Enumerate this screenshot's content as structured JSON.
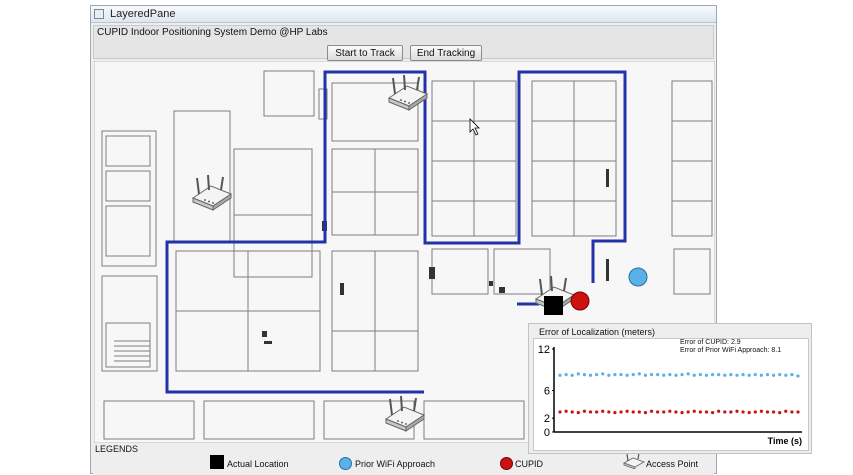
{
  "window": {
    "title": "LayeredPane"
  },
  "header": {
    "system_title": "CUPID Indoor Positioning System Demo @HP Labs",
    "start_button": "Start to Track",
    "end_button": "End Tracking"
  },
  "legend": {
    "title": "LEGENDS",
    "actual_location": "Actual Location",
    "prior_wifi": "Prior WiFi Approach",
    "cupid": "CUPID",
    "access_point": "Access Point"
  },
  "chart": {
    "panel_title": "Error of Localization (meters)",
    "cupid_error_text": "Error of CUPID: 2.9",
    "prior_error_text": "Error of Prior WiFi Approach: 8.1",
    "xlabel": "Time (s)"
  },
  "chart_data": {
    "type": "scatter",
    "title": "Error of Localization (meters)",
    "xlabel": "Time (s)",
    "ylabel": "",
    "ylim": [
      0,
      12
    ],
    "yticks": [
      "0",
      "2",
      "6",
      "12"
    ],
    "x": [
      1,
      2,
      3,
      4,
      5,
      6,
      7,
      8,
      9,
      10,
      11,
      12,
      13,
      14,
      15,
      16,
      17,
      18,
      19,
      20,
      21,
      22,
      23,
      24,
      25,
      26,
      27,
      28,
      29,
      30,
      31,
      32,
      33,
      34,
      35,
      36,
      37,
      38,
      39,
      40
    ],
    "series": [
      {
        "color": "#5ab0e8",
        "values": [
          8.2,
          8.3,
          8.2,
          8.4,
          8.3,
          8.2,
          8.3,
          8.4,
          8.2,
          8.3,
          8.3,
          8.2,
          8.3,
          8.4,
          8.2,
          8.3,
          8.3,
          8.2,
          8.3,
          8.2,
          8.3,
          8.4,
          8.2,
          8.3,
          8.2,
          8.3,
          8.3,
          8.2,
          8.3,
          8.2,
          8.3,
          8.2,
          8.3,
          8.2,
          8.3,
          8.2,
          8.3,
          8.2,
          8.3,
          8.1
        ]
      },
      {
        "color": "#cc1111",
        "values": [
          2.9,
          3.0,
          2.9,
          2.8,
          3.0,
          2.9,
          2.9,
          3.0,
          2.9,
          2.8,
          2.9,
          3.0,
          2.9,
          2.9,
          2.8,
          3.0,
          2.9,
          2.9,
          3.0,
          2.9,
          2.8,
          2.9,
          3.0,
          2.9,
          2.9,
          2.8,
          3.0,
          2.9,
          2.9,
          3.0,
          2.9,
          2.8,
          2.9,
          3.0,
          2.9,
          2.9,
          2.8,
          3.0,
          2.9,
          2.9
        ]
      }
    ],
    "grid": false
  },
  "colors": {
    "route": "#2233aa",
    "actual": "#000000",
    "prior": "#5ab0e8",
    "cupid": "#cc1111",
    "wall": "#7d7d7d"
  },
  "icons": {
    "access_point": "access-point-icon",
    "cursor": "mouse-cursor-icon"
  }
}
